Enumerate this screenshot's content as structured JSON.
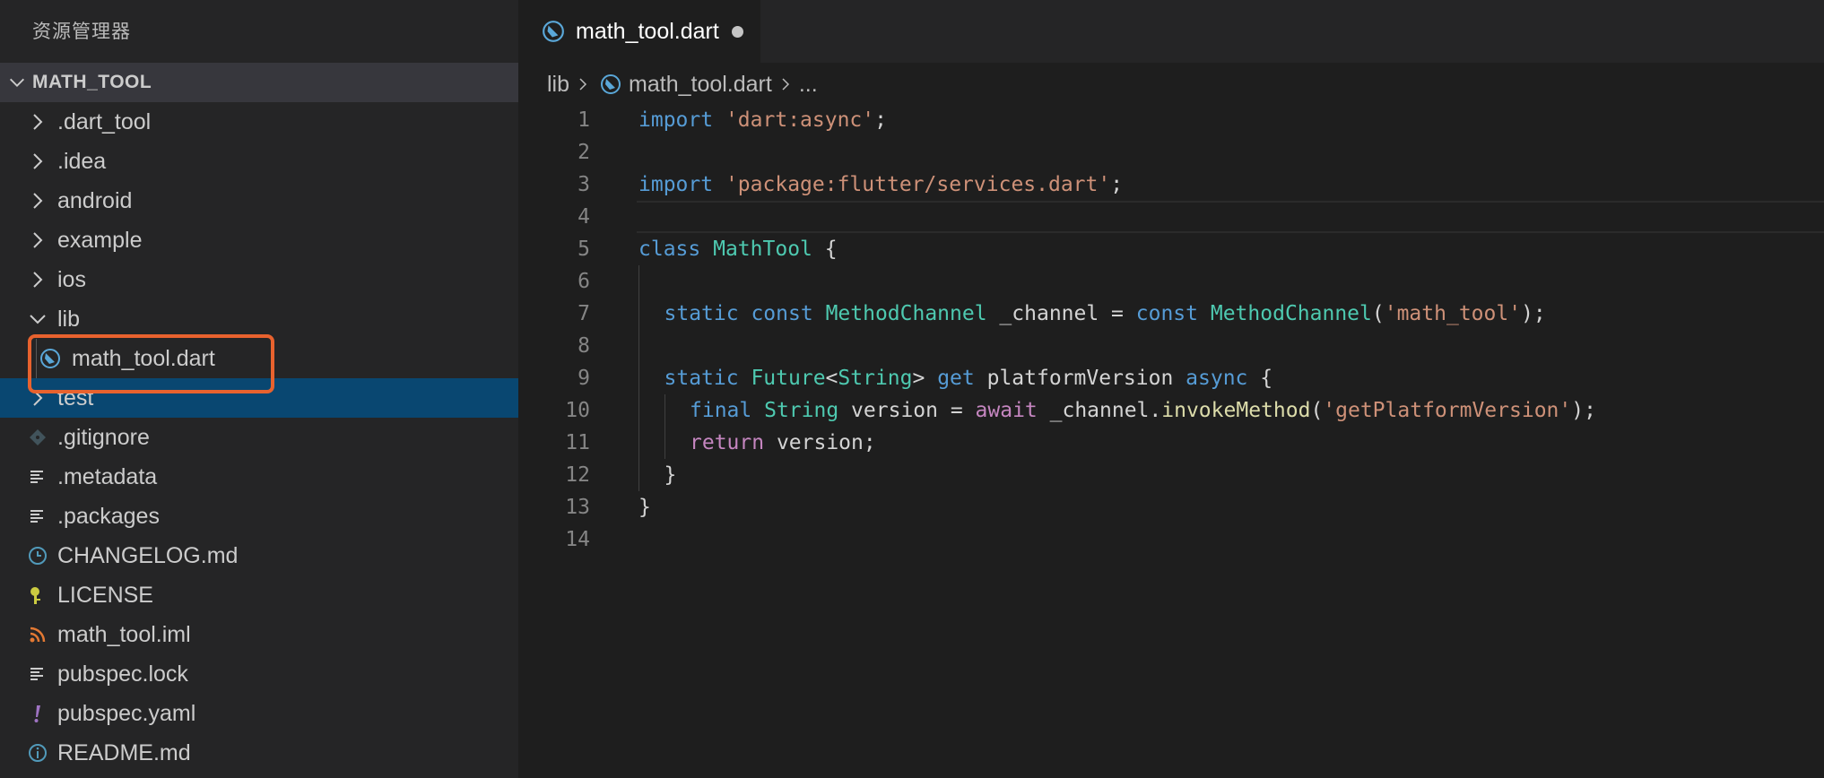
{
  "explorer": {
    "title": "资源管理器",
    "project": "MATH_TOOL",
    "items": [
      {
        "label": ".dart_tool",
        "icon": "chevron-right-icon",
        "level": 1
      },
      {
        "label": ".idea",
        "icon": "chevron-right-icon",
        "level": 1
      },
      {
        "label": "android",
        "icon": "chevron-right-icon",
        "level": 1
      },
      {
        "label": "example",
        "icon": "chevron-right-icon",
        "level": 1
      },
      {
        "label": "ios",
        "icon": "chevron-right-icon",
        "level": 1
      },
      {
        "label": "lib",
        "icon": "chevron-down-icon",
        "level": 1
      },
      {
        "label": "math_tool.dart",
        "icon": "dart-file-icon",
        "level": 2,
        "highlighted": true
      },
      {
        "label": "test",
        "icon": "chevron-right-icon",
        "level": 1,
        "selected": true
      },
      {
        "label": ".gitignore",
        "icon": "git-diamond-icon",
        "level": 1
      },
      {
        "label": ".metadata",
        "icon": "text-lines-icon",
        "level": 1
      },
      {
        "label": ".packages",
        "icon": "text-lines-icon",
        "level": 1
      },
      {
        "label": "CHANGELOG.md",
        "icon": "clock-icon",
        "level": 1
      },
      {
        "label": "LICENSE",
        "icon": "key-icon",
        "level": 1
      },
      {
        "label": "math_tool.iml",
        "icon": "rss-icon",
        "level": 1
      },
      {
        "label": "pubspec.lock",
        "icon": "text-lines-icon",
        "level": 1
      },
      {
        "label": "pubspec.yaml",
        "icon": "exclamation-icon",
        "level": 1
      },
      {
        "label": "README.md",
        "icon": "info-icon",
        "level": 1
      }
    ]
  },
  "editor": {
    "tab": {
      "label": "math_tool.dart",
      "unsaved": true
    },
    "breadcrumb": {
      "folder": "lib",
      "file": "math_tool.dart",
      "more": "..."
    },
    "current_line": 4,
    "lines": [
      {
        "n": "1",
        "indent": 0,
        "tokens": [
          [
            "kw",
            "import"
          ],
          [
            "pl",
            " "
          ],
          [
            "str",
            "'dart:async'"
          ],
          [
            "pl",
            ";"
          ]
        ]
      },
      {
        "n": "2",
        "indent": 0,
        "tokens": []
      },
      {
        "n": "3",
        "indent": 0,
        "tokens": [
          [
            "kw",
            "import"
          ],
          [
            "pl",
            " "
          ],
          [
            "str",
            "'package:flutter/services.dart'"
          ],
          [
            "pl",
            ";"
          ]
        ]
      },
      {
        "n": "4",
        "indent": 0,
        "tokens": []
      },
      {
        "n": "5",
        "indent": 0,
        "tokens": [
          [
            "kw",
            "class"
          ],
          [
            "pl",
            " "
          ],
          [
            "ty",
            "MathTool"
          ],
          [
            "pl",
            " {"
          ]
        ]
      },
      {
        "n": "6",
        "indent": 1,
        "tokens": []
      },
      {
        "n": "7",
        "indent": 1,
        "tokens": [
          [
            "kw",
            "static"
          ],
          [
            "pl",
            " "
          ],
          [
            "kw",
            "const"
          ],
          [
            "pl",
            " "
          ],
          [
            "ty",
            "MethodChannel"
          ],
          [
            "pl",
            " _channel = "
          ],
          [
            "kw",
            "const"
          ],
          [
            "pl",
            " "
          ],
          [
            "ty",
            "MethodChannel"
          ],
          [
            "pl",
            "("
          ],
          [
            "str",
            "'math_tool'"
          ],
          [
            "pl",
            ");"
          ]
        ]
      },
      {
        "n": "8",
        "indent": 1,
        "tokens": []
      },
      {
        "n": "9",
        "indent": 1,
        "tokens": [
          [
            "kw",
            "static"
          ],
          [
            "pl",
            " "
          ],
          [
            "ty",
            "Future"
          ],
          [
            "pl",
            "<"
          ],
          [
            "ty",
            "String"
          ],
          [
            "pl",
            "> "
          ],
          [
            "kw",
            "get"
          ],
          [
            "pl",
            " platformVersion "
          ],
          [
            "kw",
            "async"
          ],
          [
            "pl",
            " {"
          ]
        ]
      },
      {
        "n": "10",
        "indent": 2,
        "tokens": [
          [
            "kw",
            "final"
          ],
          [
            "pl",
            " "
          ],
          [
            "ty",
            "String"
          ],
          [
            "pl",
            " version = "
          ],
          [
            "kw2",
            "await"
          ],
          [
            "pl",
            " _channel."
          ],
          [
            "fn",
            "invokeMethod"
          ],
          [
            "pl",
            "("
          ],
          [
            "str",
            "'getPlatformVersion'"
          ],
          [
            "pl",
            ");"
          ]
        ]
      },
      {
        "n": "11",
        "indent": 2,
        "tokens": [
          [
            "kw2",
            "return"
          ],
          [
            "pl",
            " version;"
          ]
        ]
      },
      {
        "n": "12",
        "indent": 1,
        "tokens": [
          [
            "pl",
            "}"
          ]
        ]
      },
      {
        "n": "13",
        "indent": 0,
        "tokens": [
          [
            "pl",
            "}"
          ]
        ]
      },
      {
        "n": "14",
        "indent": 0,
        "tokens": []
      }
    ]
  },
  "colors": {
    "sidebar_bg": "#252526",
    "editor_bg": "#1e1e1e",
    "selection": "#094771",
    "highlight_box": "#e8622e",
    "keyword": "#569cd6",
    "control": "#c586c0",
    "string": "#ce9178",
    "type": "#4ec9b0",
    "function": "#dcdcaa"
  }
}
